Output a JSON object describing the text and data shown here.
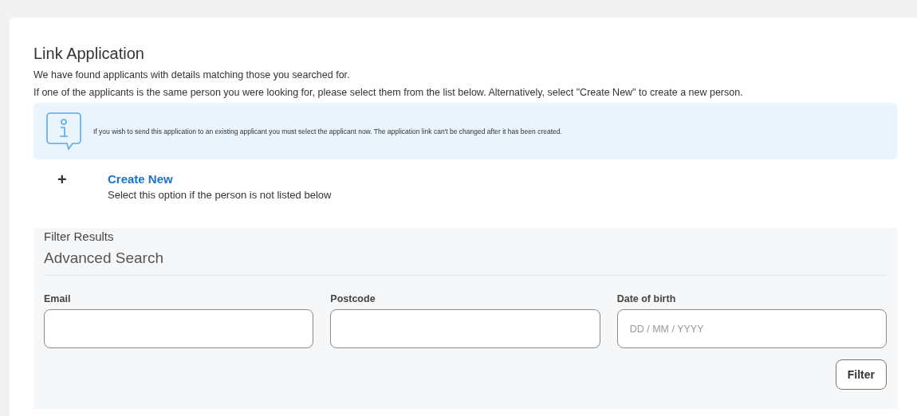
{
  "title": "Link Application",
  "intro": [
    "We have found applicants with details matching those you searched for.",
    "If one of the applicants is the same person you were looking for, please select them from the list below. Alternatively, select \"Create New\" to create a new person."
  ],
  "info": {
    "text": "If you wish to send this application to an existing applicant you must select the applicant now. The application link can't be changed after it has been created."
  },
  "create_new": {
    "icon": "+",
    "label": "Create New",
    "description": "Select this option if the person is not listed below"
  },
  "filter": {
    "title": "Filter Results",
    "subtitle": "Advanced Search",
    "fields": [
      {
        "label": "Email"
      },
      {
        "label": "Postcode"
      },
      {
        "label": "Date of birth",
        "placeholder": "DD / MM / YYYY"
      }
    ],
    "button": "Filter"
  }
}
